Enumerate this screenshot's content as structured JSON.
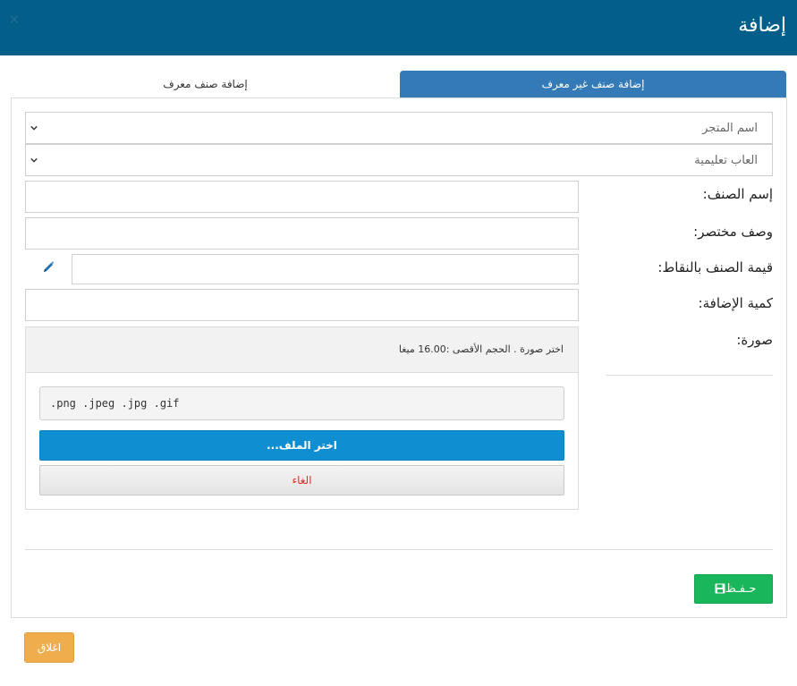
{
  "header": {
    "title": "إضافة",
    "close_glyph": "×"
  },
  "tabs": [
    {
      "label": "إضافة صنف غير معرف",
      "active": true
    },
    {
      "label": "إضافة صنف معرف",
      "active": false
    }
  ],
  "form": {
    "store_select": {
      "value": "اسم المتجر"
    },
    "category_select": {
      "value": "العاب تعليمية"
    },
    "fields": [
      {
        "label": "إسم الصنف:",
        "value": ""
      },
      {
        "label": "وصف مختصر:",
        "value": ""
      },
      {
        "label": "قيمة الصنف بالنقاط:",
        "value": ""
      },
      {
        "label": "كمية الإضافة:",
        "value": ""
      },
      {
        "label": "صورة:"
      }
    ],
    "upload": {
      "note": "اختر صورة . الحجم الأقصى :16.00 ميغا",
      "extensions": ".png .jpeg .jpg .gif",
      "choose_label": "اختر الملف...",
      "cancel_label": "الغاء"
    },
    "save_label": "حـفـظ"
  },
  "footer": {
    "close_label": "اغلاق"
  },
  "colors": {
    "header_bg": "#035e8a",
    "tab_active_bg": "#337ab7",
    "choose_button": "#0f8fd2",
    "save_button": "#19b65c",
    "close_button": "#f0ad4e",
    "cancel_text": "#d9302c"
  },
  "icons": {
    "close": "close-icon",
    "dropdown": "chevron-down-icon",
    "edit": "pen-icon",
    "save": "floppy-disk-icon"
  }
}
